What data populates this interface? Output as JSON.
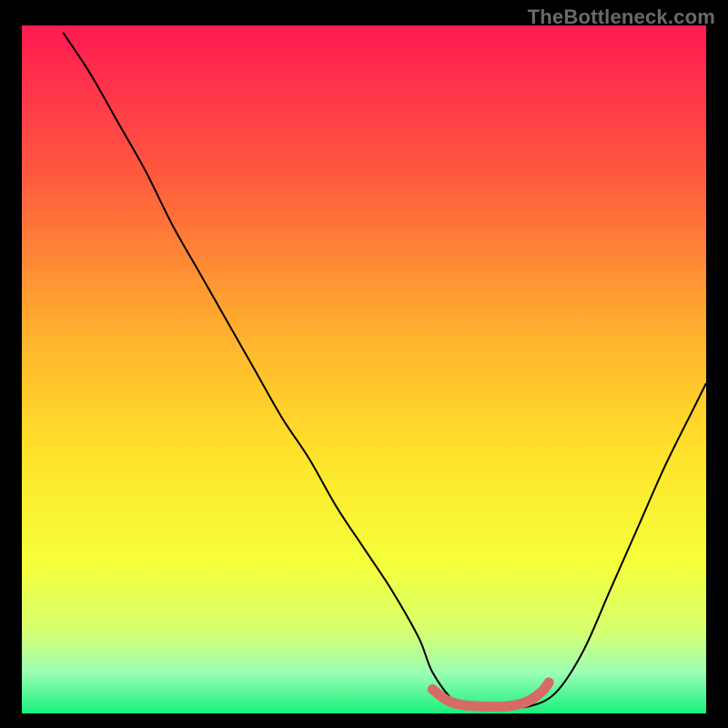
{
  "watermark": "TheBottleneck.com",
  "chart_data": {
    "type": "line",
    "title": "",
    "xlabel": "",
    "ylabel": "",
    "xlim": [
      0,
      100
    ],
    "ylim": [
      0,
      100
    ],
    "grid": false,
    "legend": false,
    "background_gradient": {
      "stops": [
        {
          "pos": 0.0,
          "color": "#ff1a52"
        },
        {
          "pos": 0.22,
          "color": "#ff5a3e"
        },
        {
          "pos": 0.45,
          "color": "#ffb22e"
        },
        {
          "pos": 0.62,
          "color": "#ffe22a"
        },
        {
          "pos": 0.78,
          "color": "#f5ff3a"
        },
        {
          "pos": 0.88,
          "color": "#d6ff70"
        },
        {
          "pos": 0.94,
          "color": "#9cffb4"
        },
        {
          "pos": 1.0,
          "color": "#18f07c"
        }
      ]
    },
    "series": [
      {
        "name": "bottleneck-curve",
        "x": [
          6,
          10,
          14,
          18,
          22,
          26,
          30,
          34,
          38,
          42,
          46,
          50,
          54,
          58,
          60,
          63,
          66,
          70,
          74,
          78,
          82,
          86,
          90,
          94,
          98,
          100
        ],
        "y": [
          99,
          93,
          86,
          79,
          71,
          64,
          57,
          50,
          43,
          37,
          30,
          24,
          18,
          11,
          6,
          2,
          1,
          1,
          1,
          3,
          9,
          18,
          27,
          36,
          44,
          48
        ]
      }
    ],
    "highlight": {
      "name": "optimal-band",
      "color": "#d66a67",
      "x": [
        60,
        62,
        64,
        66,
        68,
        70,
        72,
        74,
        76,
        77
      ],
      "y": [
        3.5,
        2.0,
        1.3,
        1.1,
        1.0,
        1.0,
        1.2,
        1.8,
        3.2,
        4.5
      ]
    }
  }
}
